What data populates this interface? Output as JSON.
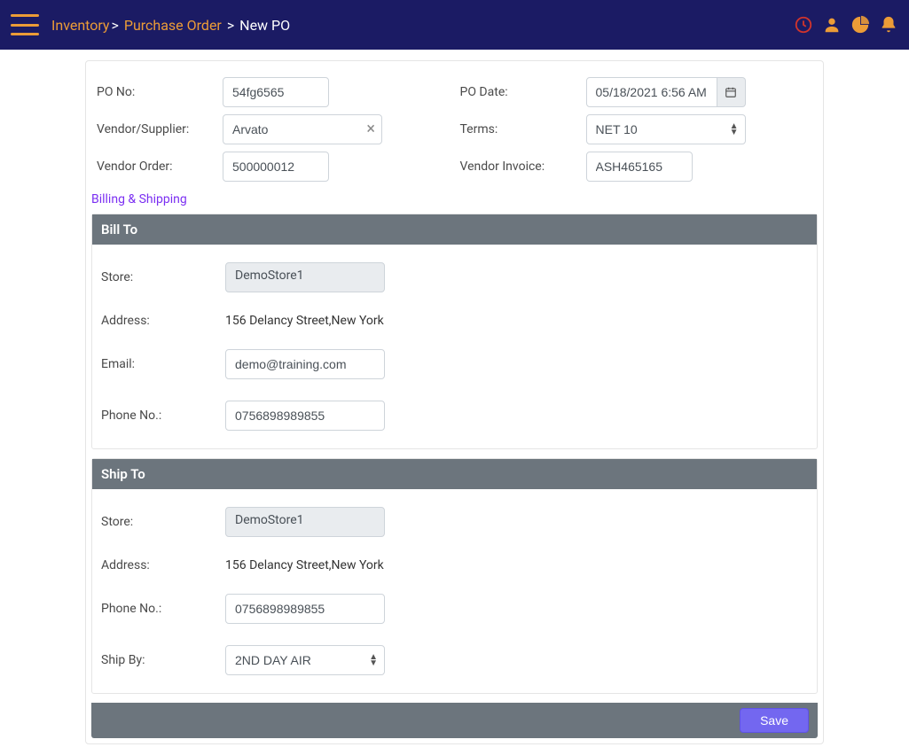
{
  "breadcrumb": {
    "link1": "Inventory",
    "link2": "Purchase Order",
    "current": "New PO"
  },
  "fields": {
    "po_no_label": "PO No:",
    "po_no_value": "54fg6565",
    "po_date_label": "PO Date:",
    "po_date_value": "05/18/2021 6:56 AM",
    "vendor_label": "Vendor/Supplier:",
    "vendor_value": "Arvato",
    "terms_label": "Terms:",
    "terms_value": "NET 10",
    "vendor_order_label": "Vendor Order:",
    "vendor_order_value": "500000012",
    "vendor_invoice_label": "Vendor Invoice:",
    "vendor_invoice_value": "ASH465165"
  },
  "billing_shipping_link": "Billing & Shipping",
  "bill_to": {
    "title": "Bill To",
    "store_label": "Store:",
    "store_value": "DemoStore1",
    "address_label": "Address:",
    "address_value": "156 Delancy Street,New York",
    "email_label": "Email:",
    "email_value": "demo@training.com",
    "phone_label": "Phone No.:",
    "phone_value": "0756898989855"
  },
  "ship_to": {
    "title": "Ship To",
    "store_label": "Store:",
    "store_value": "DemoStore1",
    "address_label": "Address:",
    "address_value": "156 Delancy Street,New York",
    "phone_label": "Phone No.:",
    "phone_value": "0756898989855",
    "ship_by_label": "Ship By:",
    "ship_by_value": "2ND DAY AIR"
  },
  "actions": {
    "save": "Save"
  }
}
